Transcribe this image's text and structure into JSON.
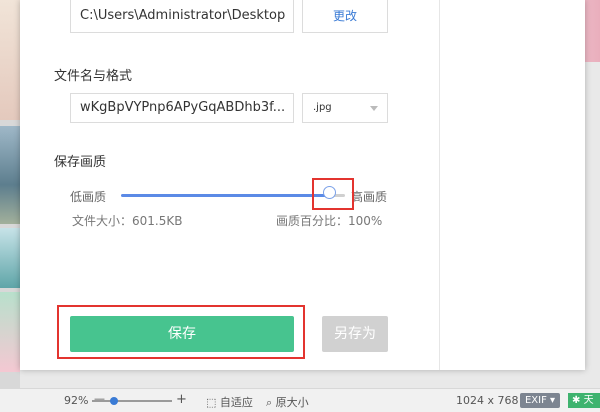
{
  "save_path": {
    "value": "C:\\Users\\Administrator\\Desktop",
    "change_label": "更改"
  },
  "filename_format": {
    "label": "文件名与格式",
    "filename": "wKgBpVYPnp6APyGqABDhb3f...",
    "format": ".jpg"
  },
  "quality": {
    "label": "保存画质",
    "low_label": "低画质",
    "high_label": "高画质",
    "file_size": "文件大小：601.5KB",
    "percent_text": "画质百分比：100%",
    "level_percent": 100
  },
  "actions": {
    "save_label": "保存",
    "save_as_label": "另存为"
  },
  "preview": {
    "close_icon": "×"
  },
  "statusbar": {
    "zoom": "92%",
    "zoom_minus": "—",
    "zoom_plus": "+",
    "fit_label": "自适应",
    "original_label": "原大小",
    "dimensions": "1024 x 768",
    "exif_label": "EXIF",
    "exif_chevron": "▾",
    "extra_label": "天"
  },
  "colors": {
    "accent_green": "#47c48f",
    "accent_blue": "#5b8ae6",
    "highlight_red": "#e3342f"
  }
}
